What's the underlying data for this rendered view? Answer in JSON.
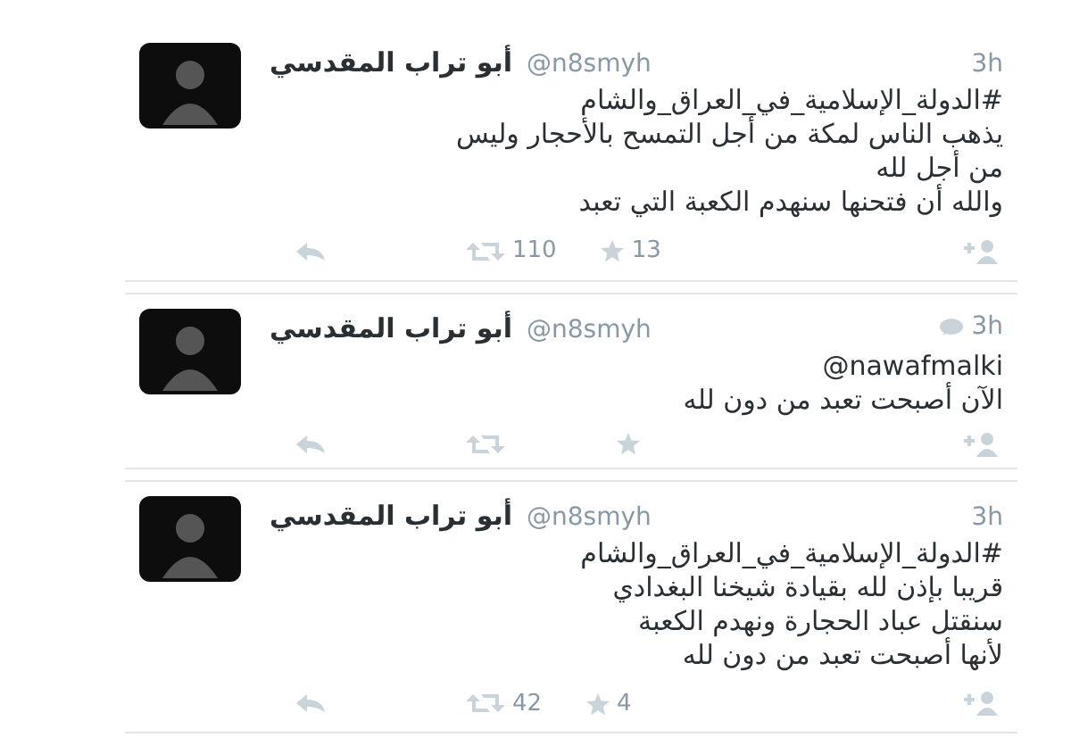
{
  "tweets": [
    {
      "name": "أبو تراب المقدسي",
      "handle": "@n8smyh",
      "time": "3h",
      "conversation": false,
      "lines": [
        "#الدولة_الإسلامية_في_العراق_والشام",
        "يذهب الناس لمكة من أجل التمسح بالأحجار وليس",
        "من أجل لله",
        "والله أن فتحنها سنهدم الكعبة التي تعبد"
      ],
      "retweets": "110",
      "favorites": "13"
    },
    {
      "name": "أبو تراب المقدسي",
      "handle": "@n8smyh",
      "time": "3h",
      "conversation": true,
      "lines": [
        "@nawafmalki",
        "الآن أصبحت تعبد من دون لله"
      ]
    },
    {
      "name": "أبو تراب المقدسي",
      "handle": "@n8smyh",
      "time": "3h",
      "conversation": false,
      "lines": [
        "#الدولة_الإسلامية_في_العراق_والشام",
        "قريبا بإذن لله بقيادة شيخنا البغدادي",
        "سنقتل عباد الحجارة ونهدم الكعبة",
        "لأنها أصبحت تعبد من دون لله"
      ],
      "retweets": "42",
      "favorites": "4"
    }
  ]
}
